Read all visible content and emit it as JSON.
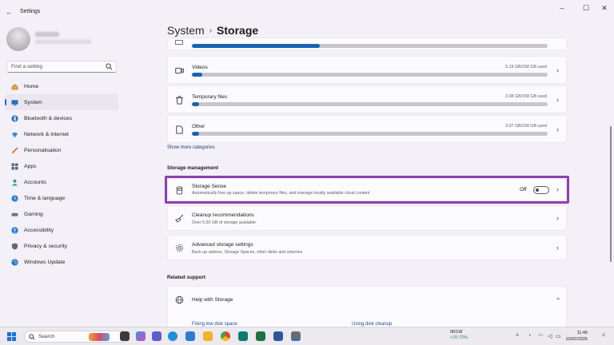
{
  "window": {
    "title": "Settings",
    "back_glyph": "←",
    "controls": {
      "minimize": "–",
      "maximize": "☐",
      "close": "✕"
    }
  },
  "sidebar": {
    "search_placeholder": "Find a setting",
    "items": [
      {
        "label": "Home",
        "icon": "home-icon",
        "active": false
      },
      {
        "label": "System",
        "icon": "system-icon",
        "active": true
      },
      {
        "label": "Bluetooth & devices",
        "icon": "bluetooth-icon",
        "active": false
      },
      {
        "label": "Network & internet",
        "icon": "wifi-icon",
        "active": false
      },
      {
        "label": "Personalisation",
        "icon": "brush-icon",
        "active": false
      },
      {
        "label": "Apps",
        "icon": "apps-icon",
        "active": false
      },
      {
        "label": "Accounts",
        "icon": "accounts-icon",
        "active": false
      },
      {
        "label": "Time & language",
        "icon": "globe-clock-icon",
        "active": false
      },
      {
        "label": "Gaming",
        "icon": "gamepad-icon",
        "active": false
      },
      {
        "label": "Accessibility",
        "icon": "accessibility-icon",
        "active": false
      },
      {
        "label": "Privacy & security",
        "icon": "shield-icon",
        "active": false
      },
      {
        "label": "Windows Update",
        "icon": "update-icon",
        "active": false
      }
    ]
  },
  "breadcrumb": {
    "parent": "System",
    "separator": "›",
    "current": "Storage"
  },
  "storage_items": [
    {
      "label": "",
      "used": "",
      "fill": 0.36,
      "icon": "apps-storage-icon"
    },
    {
      "label": "Videos",
      "used": "5.19 GB/158 GB used",
      "fill": 0.03,
      "icon": "video-icon"
    },
    {
      "label": "Temporary files",
      "used": "3.08 GB/158 GB used",
      "fill": 0.02,
      "icon": "trash-icon"
    },
    {
      "label": "Other",
      "used": "3.07 GB/158 GB used",
      "fill": 0.02,
      "icon": "file-icon"
    }
  ],
  "show_more": "Show more categories",
  "storage_management": {
    "heading": "Storage management",
    "storage_sense": {
      "title": "Storage Sense",
      "description": "Automatically free up space, delete temporary files, and manage locally available cloud content",
      "state_label": "Off",
      "on": false
    },
    "cleanup": {
      "title": "Cleanup recommendations",
      "description": "Over 5.00 GB of storage available."
    },
    "advanced": {
      "title": "Advanced storage settings",
      "description": "Back up options, Storage Spaces, other disks and volumes"
    }
  },
  "related_support": {
    "heading": "Related support",
    "help_title": "Help with Storage",
    "links": [
      "Fixing low disk space",
      "Using disk cleanup"
    ]
  },
  "taskbar": {
    "search_label": "Search",
    "stock_name": "0R1W",
    "stock_change": "+70.72%",
    "time": "11:46",
    "date": "10/02/2025"
  },
  "colors": {
    "accent": "#1864b4",
    "highlight": "#8e3fb3"
  }
}
